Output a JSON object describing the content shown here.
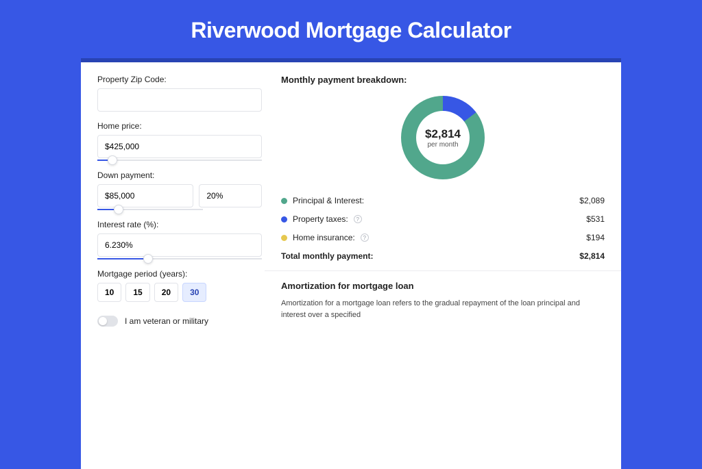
{
  "title": "Riverwood Mortgage Calculator",
  "form": {
    "zip_label": "Property Zip Code:",
    "zip_value": "",
    "homeprice_label": "Home price:",
    "homeprice_value": "$425,000",
    "homeprice_slider_pct": 9,
    "down_label": "Down payment:",
    "down_value": "$85,000",
    "down_pct": "20%",
    "down_slider_pct": 20,
    "rate_label": "Interest rate (%):",
    "rate_value": "6.230%",
    "rate_slider_pct": 31,
    "period_label": "Mortgage period (years):",
    "period_opts": [
      "10",
      "15",
      "20",
      "30"
    ],
    "period_active": 3,
    "toggle_label": "I am veteran or military"
  },
  "breakdown": {
    "title": "Monthly payment breakdown:",
    "donut_amount": "$2,814",
    "donut_sub": "per month",
    "rows": [
      {
        "label": "Principal & Interest:",
        "value": "$2,089",
        "color": "g",
        "info": false
      },
      {
        "label": "Property taxes:",
        "value": "$531",
        "color": "b",
        "info": true
      },
      {
        "label": "Home insurance:",
        "value": "$194",
        "color": "y",
        "info": true
      }
    ],
    "total_label": "Total monthly payment:",
    "total_value": "$2,814"
  },
  "chart_data": {
    "type": "pie",
    "title": "Monthly payment breakdown",
    "series": [
      {
        "name": "Principal & Interest",
        "value": 2089,
        "color": "#51a78c"
      },
      {
        "name": "Property taxes",
        "value": 531,
        "color": "#3757e5"
      },
      {
        "name": "Home insurance",
        "value": 194,
        "color": "#e6c84f"
      }
    ],
    "center_label": "$2,814 per month"
  },
  "amort": {
    "title": "Amortization for mortgage loan",
    "body": "Amortization for a mortgage loan refers to the gradual repayment of the loan principal and interest over a specified"
  }
}
